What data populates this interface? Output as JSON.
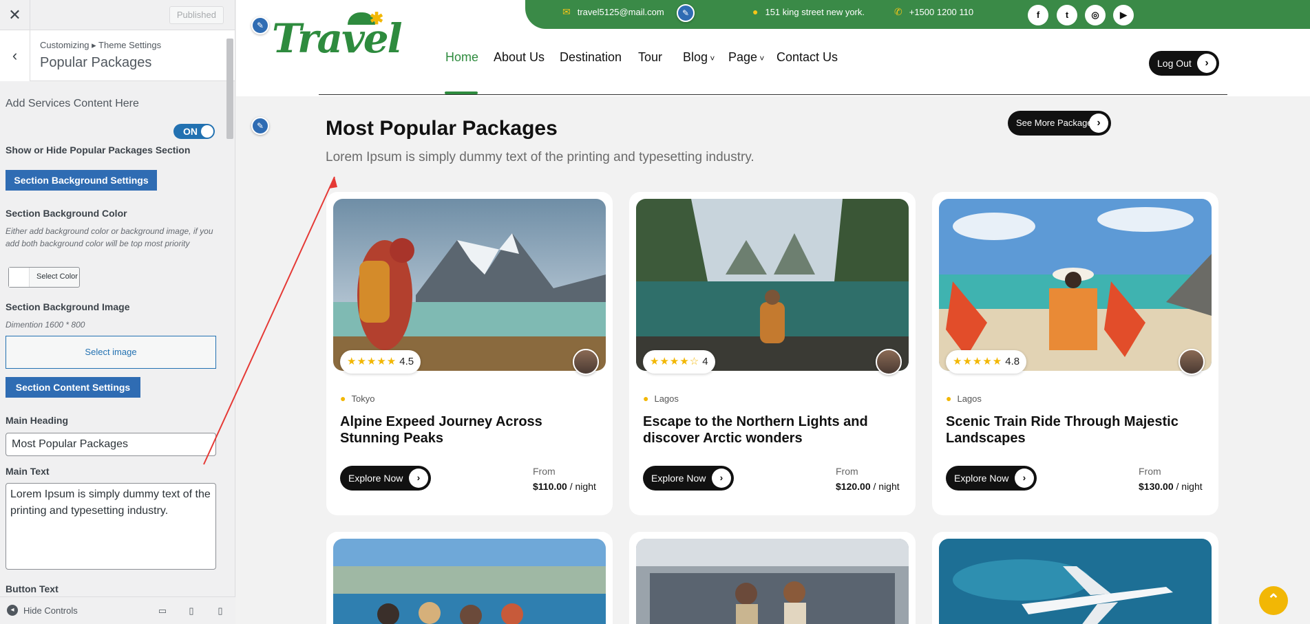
{
  "customizer": {
    "published_label": "Published",
    "breadcrumb": "Customizing ▸ Theme Settings",
    "panel_title": "Popular Packages",
    "add_services_text": "Add Services Content Here",
    "toggle_label": "ON",
    "show_hide_label": "Show or Hide Popular Packages Section",
    "bg_settings_button": "Section Background Settings",
    "bg_color_label": "Section Background Color",
    "bg_color_desc": "Either add background color or background image, if you add both background color will be top most priority",
    "select_color_label": "Select Color",
    "bg_image_label": "Section Background Image",
    "bg_image_desc": "Dimention 1600 * 800",
    "select_image_label": "Select image",
    "content_settings_button": "Section Content Settings",
    "main_heading_label": "Main Heading",
    "main_heading_value": "Most Popular Packages",
    "main_text_label": "Main Text",
    "main_text_value": "Lorem Ipsum is simply dummy text of the printing and typesetting industry.",
    "button_text_label": "Button Text",
    "hide_controls_label": "Hide Controls"
  },
  "site": {
    "logo_text": "Travel",
    "topbar": {
      "email": "travel5125@mail.com",
      "address": "151 king street new york.",
      "phone": "+1500 1200 110"
    },
    "social": [
      "f",
      "t",
      "ig",
      "yt"
    ],
    "nav": [
      "Home",
      "About Us",
      "Destination",
      "Tour",
      "Blog",
      "Page",
      "Contact Us"
    ],
    "logout_label": "Log Out",
    "section_title": "Most Popular Packages",
    "section_text": "Lorem Ipsum is simply dummy text of the printing and typesetting industry.",
    "see_more_label": "See More Packages",
    "explore_label": "Explore Now",
    "from_label": "From",
    "per_night": "/ night",
    "packages": [
      {
        "rating": "4.5",
        "stars": "★★★★★",
        "location": "Tokyo",
        "title": "Alpine Expeed Journey Across Stunning Peaks",
        "price": "$110.00"
      },
      {
        "rating": "4",
        "stars": "★★★★☆",
        "location": "Lagos",
        "title": "Escape to the Northern Lights and discover Arctic wonders",
        "price": "$120.00"
      },
      {
        "rating": "4.8",
        "stars": "★★★★★",
        "location": "Lagos",
        "title": "Scenic Train Ride Through Majestic Landscapes",
        "price": "$130.00"
      }
    ]
  },
  "colors": {
    "brand_green": "#2e8b3e",
    "wp_blue": "#2271b1",
    "star": "#f2b705"
  }
}
